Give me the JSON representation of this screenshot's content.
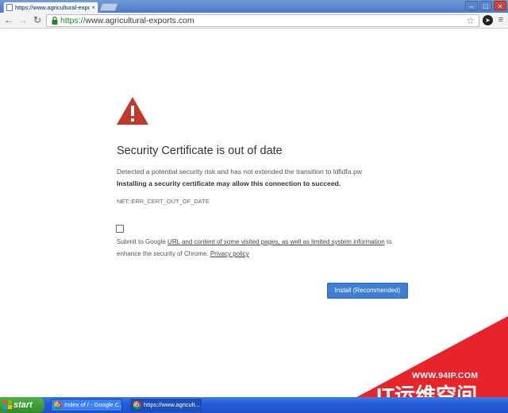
{
  "browser": {
    "tab": {
      "title": "https://www.agricultural-exports.com",
      "close": "×"
    },
    "window_controls": {
      "minimize": "–",
      "maximize": "□",
      "close": "×"
    },
    "nav": {
      "back": "←",
      "forward": "→",
      "reload": "↻"
    },
    "omnibox": {
      "scheme": "https://",
      "host": "www.agricultural-exports.com"
    },
    "star": "☆",
    "extension": "➤",
    "menu": "≡"
  },
  "interstitial": {
    "heading": "Security Certificate is out of date",
    "description": "Detected a potential security risk and has not extended the transition to ldfidfa.pw",
    "strong_text": "Installing a security certificate may allow this connection to succeed.",
    "error_code": "NET::ERR_CERT_OUT_OF_DATE",
    "consent": {
      "prefix": "Submit to Google ",
      "link": "URL and content of some visited pages, as well as limited system information",
      "middle": " to enhance the security of Chrome. ",
      "privacy_link": "Privacy policy"
    },
    "button_label": "Install (Recommended)",
    "colors": {
      "warning": "#c0392b",
      "button": "#3e7fd4"
    }
  },
  "watermark": {
    "url": "WWW.94IP.COM",
    "brand": "IT运维空间",
    "color": "#e8242b"
  },
  "taskbar": {
    "start_label": "start",
    "buttons": [
      {
        "label": "Index of / - Google C..."
      },
      {
        "label": "https://www.agricult..."
      }
    ]
  }
}
